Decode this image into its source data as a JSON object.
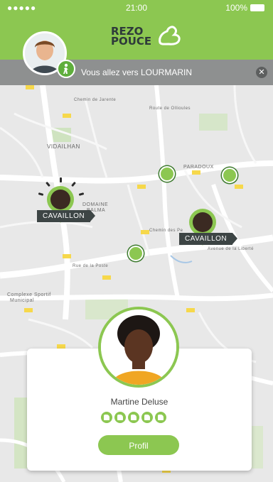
{
  "statusbar": {
    "signal": "●●●●● ",
    "time": "21:00",
    "battery": "100%"
  },
  "header": {
    "logo_line1": "REZO",
    "logo_line2": "POUCE"
  },
  "destination": {
    "text": "Vous allez vers LOURMARIN",
    "close_icon": "close-icon"
  },
  "map": {
    "labels": [
      "VIDAILHAN",
      "PARADOUX",
      "DOMAINE",
      "BALMA",
      "Complexe Sportif",
      "Municipal",
      "Chemin des Pe",
      "Avenue de la Liberté",
      "Rue de la Poste",
      "Chemin de Jarente",
      "Route de Ollioules"
    ]
  },
  "drivers": [
    {
      "label": "CAVAILLON"
    },
    {
      "label": "CAVAILLON"
    }
  ],
  "card": {
    "name": "Martine Deluse",
    "rating": 5,
    "profile_label": "Profil"
  },
  "colors": {
    "accent": "#8cc751",
    "dark": "#3d4545"
  }
}
